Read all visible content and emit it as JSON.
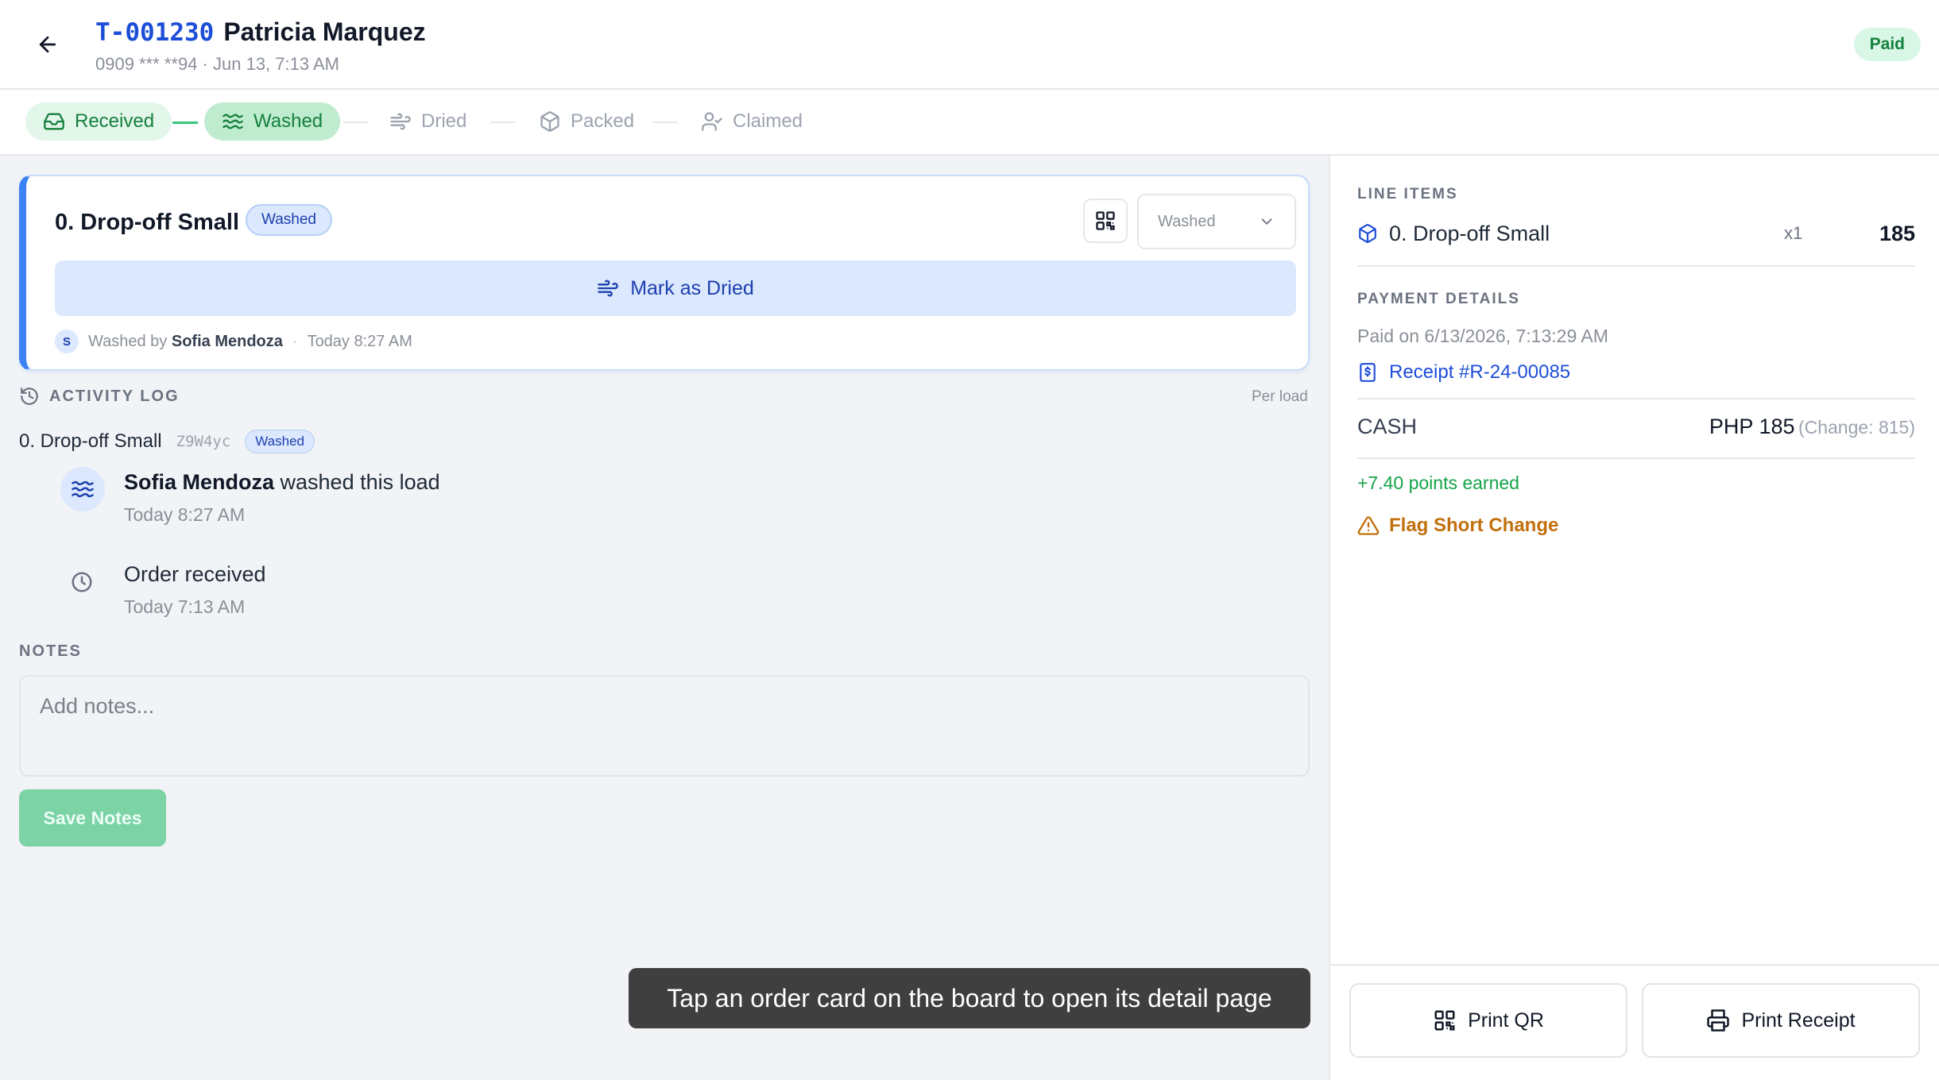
{
  "header": {
    "order_id": "T-001230",
    "customer_name": "Patricia Marquez",
    "subtitle": "0909 *** **94 · Jun 13, 7:13 AM",
    "status_badge": "Paid"
  },
  "stepper": {
    "steps": [
      {
        "label": "Received",
        "icon": "inbox-icon",
        "state": "done"
      },
      {
        "label": "Washed",
        "icon": "waves-icon",
        "state": "current"
      },
      {
        "label": "Dried",
        "icon": "wind-icon",
        "state": "pending"
      },
      {
        "label": "Packed",
        "icon": "package-icon",
        "state": "pending"
      },
      {
        "label": "Claimed",
        "icon": "user-check-icon",
        "state": "pending"
      }
    ]
  },
  "load_card": {
    "title": "0. Drop-off Small",
    "status_pill": "Washed",
    "select_value": "Washed",
    "action_label": "Mark as Dried",
    "avatar_initial": "S",
    "washed_by_prefix": "Washed by",
    "washed_by_name": "Sofia Mendoza",
    "separator": "·",
    "time": "Today 8:27 AM"
  },
  "activity": {
    "title": "ACTIVITY LOG",
    "scope": "Per load",
    "load_name": "0. Drop-off Small",
    "load_code": "Z9W4yc",
    "load_status": "Washed",
    "entries": [
      {
        "actor": "Sofia Mendoza",
        "text": "washed this load",
        "time": "Today 8:27 AM",
        "icon": "waves-icon"
      },
      {
        "actor": "",
        "text": "Order received",
        "time": "Today 7:13 AM",
        "icon": "clock-icon"
      }
    ]
  },
  "notes": {
    "title": "NOTES",
    "placeholder": "Add notes...",
    "value": "",
    "save_label": "Save Notes"
  },
  "toast": "Tap an order card on the board to open its detail page",
  "right_panel": {
    "line_items_title": "LINE ITEMS",
    "line_items": [
      {
        "name": "0. Drop-off Small",
        "qty": "x1",
        "price": "185"
      }
    ],
    "payment_title": "PAYMENT DETAILS",
    "paid_on": "Paid on 6/13/2026, 7:13:29 AM",
    "receipt_label": "Receipt #R-24-00085",
    "method": "CASH",
    "amount": "PHP 185",
    "change": "(Change: 815)",
    "points": "+7.40 points earned",
    "flag_label": "Flag Short Change",
    "print_qr_label": "Print QR",
    "print_receipt_label": "Print Receipt"
  },
  "colors": {
    "accent_blue": "#1d4ed8",
    "success_green": "#15803d",
    "warning_orange": "#c2700c"
  }
}
